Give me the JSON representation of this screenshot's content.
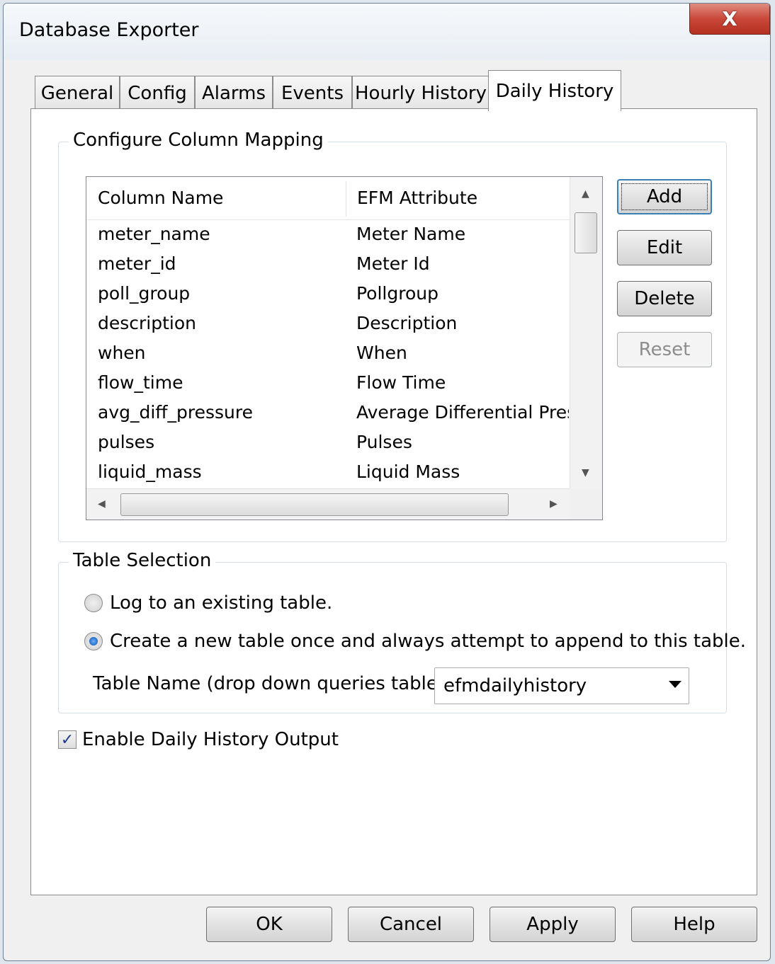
{
  "window": {
    "title": "Database Exporter",
    "close_glyph": "X"
  },
  "tabs": [
    {
      "label": "General"
    },
    {
      "label": "Config"
    },
    {
      "label": "Alarms"
    },
    {
      "label": "Events"
    },
    {
      "label": "Hourly History"
    },
    {
      "label": "Daily History",
      "active": true
    }
  ],
  "mapping": {
    "group_label": "Configure Column Mapping",
    "headers": {
      "col1": "Column Name",
      "col2": "EFM Attribute"
    },
    "rows": [
      {
        "column": "meter_name",
        "attribute": "Meter Name"
      },
      {
        "column": "meter_id",
        "attribute": "Meter Id"
      },
      {
        "column": "poll_group",
        "attribute": "Pollgroup"
      },
      {
        "column": "description",
        "attribute": "Description"
      },
      {
        "column": "when",
        "attribute": "When"
      },
      {
        "column": "flow_time",
        "attribute": "Flow Time"
      },
      {
        "column": "avg_diff_pressure",
        "attribute": "Average Differential Pres"
      },
      {
        "column": "pulses",
        "attribute": "Pulses"
      },
      {
        "column": "liquid_mass",
        "attribute": "Liquid Mass"
      }
    ],
    "buttons": {
      "add": "Add",
      "edit": "Edit",
      "delete": "Delete",
      "reset": "Reset"
    }
  },
  "table_selection": {
    "group_label": "Table Selection",
    "option_existing": "Log to an existing table.",
    "option_create": "Create a new table once and always attempt to append to this table.",
    "selected_option": "create",
    "table_name_label": "Table Name (drop down queries tables)",
    "table_name_value": "efmdailyhistory"
  },
  "enable_output": {
    "label": "Enable Daily History Output",
    "checked": true
  },
  "footer": {
    "ok": "OK",
    "cancel": "Cancel",
    "apply": "Apply",
    "help": "Help"
  }
}
